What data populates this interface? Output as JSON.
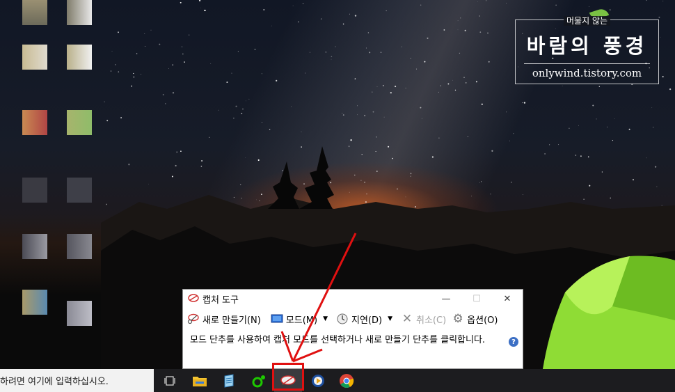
{
  "widget": {
    "subtitle": "머물지 않는",
    "title": "바람의 풍경",
    "url": "onlywind.tistory.com"
  },
  "snipping_tool": {
    "title": "캡처 도구",
    "window_controls": {
      "minimize": "—",
      "maximize": "☐",
      "close": "✕"
    },
    "toolbar": {
      "new": "새로 만들기(N)",
      "mode": "모드(M)",
      "delay": "지연(D)",
      "cancel": "취소(C)",
      "options": "옵션(O)"
    },
    "message": "모드 단추를 사용하여 캡처 모드를 선택하거나 새로 만들기 단추를 클릭합니다.",
    "help": "?"
  },
  "taskbar": {
    "search_text": "하려면 여기에 입력하십시오.",
    "apps": [
      "task-view-icon",
      "file-explorer-icon",
      "notepad-icon",
      "naver-whale-icon",
      "snipping-tool-icon",
      "media-player-icon",
      "chrome-icon"
    ]
  },
  "colors": {
    "highlight": "#e01010",
    "taskbar": "#1c1c1f",
    "tent": "#9be33a"
  }
}
